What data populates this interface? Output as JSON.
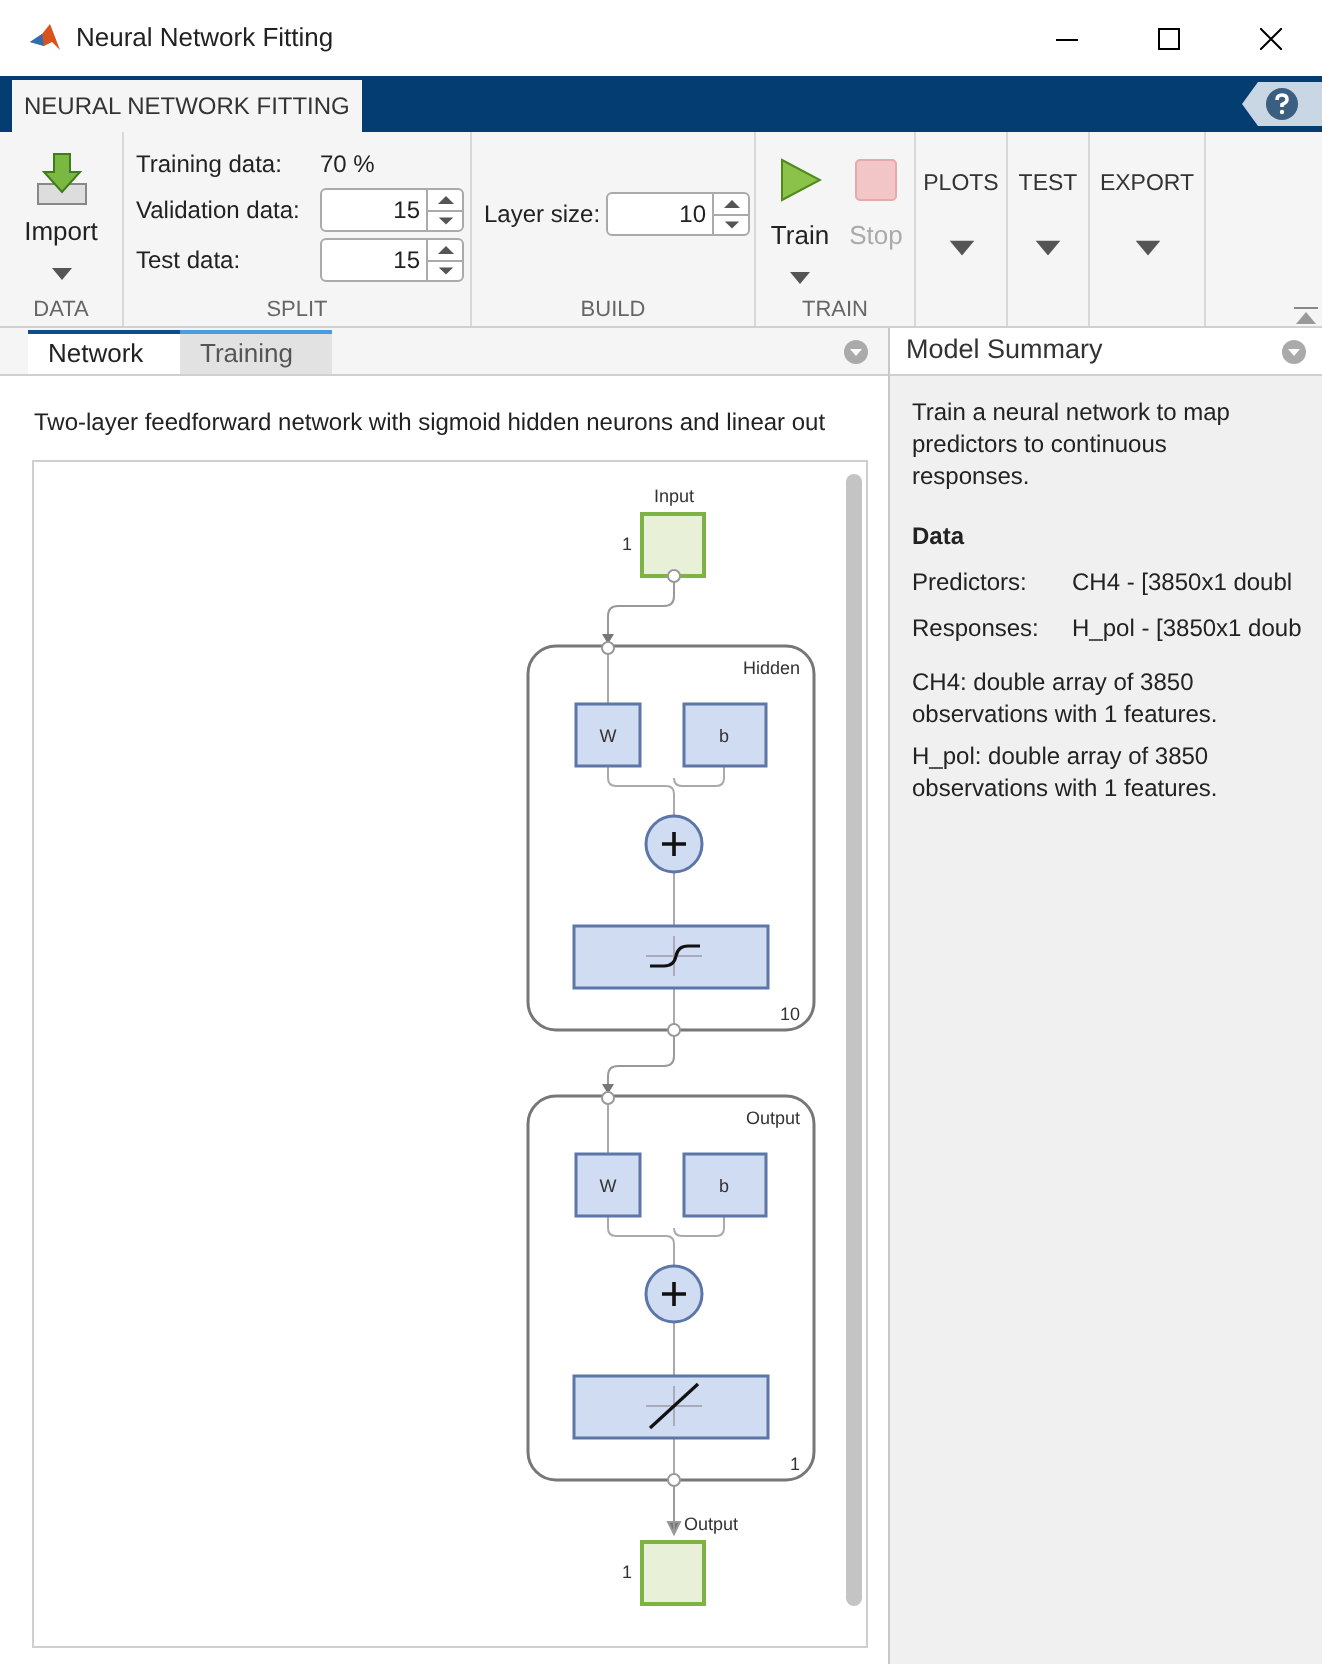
{
  "window": {
    "title": "Neural Network Fitting"
  },
  "ribbon_tabs": [
    {
      "label": "NEURAL NETWORK FITTING",
      "selected": true
    }
  ],
  "ribbon": {
    "data": {
      "import_label": "Import",
      "section": "DATA"
    },
    "split": {
      "section": "SPLIT",
      "training": {
        "label": "Training data:",
        "value": "70 %"
      },
      "spinners": [
        {
          "label": "Validation data:",
          "value": "15"
        },
        {
          "label": "Test data:",
          "value": "15"
        }
      ]
    },
    "build": {
      "section": "BUILD",
      "spinner": {
        "label": "Layer size:",
        "value": "10"
      }
    },
    "train": {
      "section": "TRAIN",
      "buttons": [
        {
          "kind": "train",
          "label": "Train",
          "disabled": false,
          "has_menu": true
        },
        {
          "kind": "stop",
          "label": "Stop",
          "disabled": true,
          "has_menu": false
        }
      ]
    },
    "menus": [
      {
        "label": "PLOTS"
      },
      {
        "label": "TEST"
      },
      {
        "label": "EXPORT"
      }
    ]
  },
  "panel_tabs": [
    {
      "label": "Network",
      "selected": true
    },
    {
      "label": "Training",
      "selected": false
    }
  ],
  "description": "Two-layer feedforward network with sigmoid hidden neurons and linear out",
  "diagram": {
    "input": {
      "label": "Input",
      "size": "1"
    },
    "layers": [
      {
        "name": "Hidden",
        "weight": "W",
        "bias": "b",
        "size": "10",
        "kind": "sigmoid"
      },
      {
        "name": "Output",
        "weight": "W",
        "bias": "b",
        "size": "1",
        "kind": "linear"
      }
    ],
    "output": {
      "label": "Output",
      "size": "1"
    }
  },
  "model_summary": {
    "title": "Model Summary",
    "intro": "Train a neural network to map predictors to continuous responses.",
    "heading": "Data",
    "rows": [
      {
        "label": "Predictors:",
        "value": "CH4 - [3850x1 doubl"
      },
      {
        "label": "Responses:",
        "value": "H_pol - [3850x1 doub"
      }
    ],
    "notes": [
      "CH4: double array of 3850 observations with 1 features.",
      "H_pol: double array of 3850 observations with 1 features."
    ]
  }
}
